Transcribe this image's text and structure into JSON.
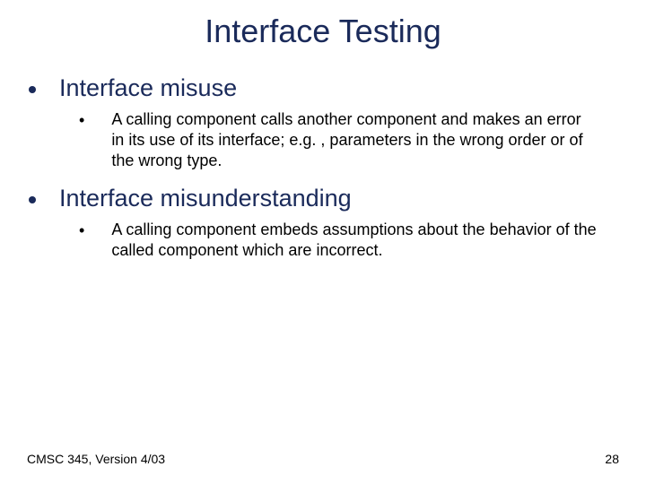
{
  "title": "Interface Testing",
  "items": [
    {
      "heading": "Interface misuse",
      "sub": "A calling component calls another component and makes an error in its use of its interface; e.g. , parameters in the wrong order or of the wrong type."
    },
    {
      "heading": "Interface misunderstanding",
      "sub": "A calling component embeds assumptions about the behavior of the called component which are incorrect."
    }
  ],
  "footer": {
    "left": "CMSC 345, Version 4/03",
    "right": "28"
  }
}
